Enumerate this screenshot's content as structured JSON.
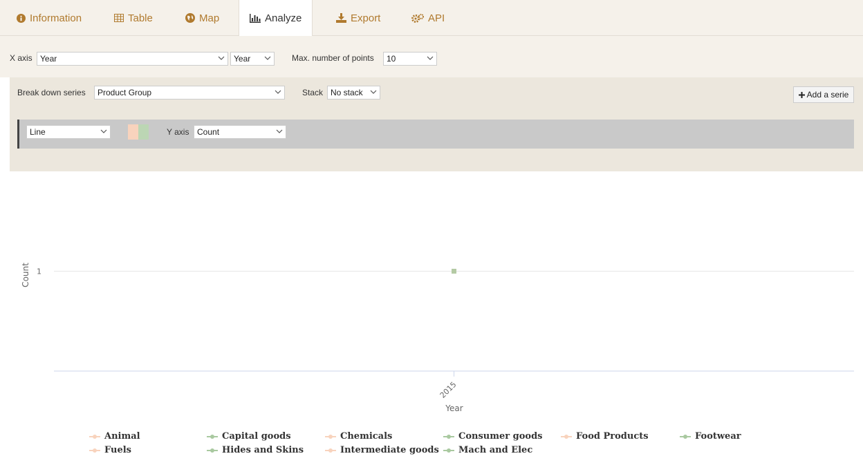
{
  "tabs": [
    {
      "label": "Information",
      "icon": "info-icon"
    },
    {
      "label": "Table",
      "icon": "table-icon"
    },
    {
      "label": "Map",
      "icon": "globe-icon"
    },
    {
      "label": "Analyze",
      "icon": "bar-chart-icon",
      "active": true
    },
    {
      "label": "Export",
      "icon": "download-icon"
    },
    {
      "label": "API",
      "icon": "cogs-icon"
    }
  ],
  "xaxis": {
    "label": "X axis",
    "field_value": "Year",
    "granularity_value": "Year",
    "max_points_label": "Max. number of points",
    "max_points_value": "10"
  },
  "breakdown": {
    "label": "Break down series",
    "value": "Product Group",
    "stack_label": "Stack",
    "stack_value": "No stack",
    "add_label": "Add a serie"
  },
  "serie": {
    "type_value": "Line",
    "yaxis_label": "Y axis",
    "yaxis_value": "Count",
    "colors": [
      "#f8d3bd",
      "#bcd6b4"
    ]
  },
  "colors": {
    "accent": "#b07a2e",
    "peach": "#f8d3bd",
    "green": "#a9c9a0"
  },
  "chart_data": {
    "type": "line",
    "x": [
      "2015"
    ],
    "xlabel": "Year",
    "ylabel": "Count",
    "y_ticks": [
      "1"
    ],
    "series": [
      {
        "name": "Animal",
        "values": [
          1
        ],
        "color": "#f8d3bd"
      },
      {
        "name": "Capital goods",
        "values": [
          1
        ],
        "color": "#a9c9a0"
      },
      {
        "name": "Chemicals",
        "values": [
          1
        ],
        "color": "#f8d3bd"
      },
      {
        "name": "Consumer goods",
        "values": [
          1
        ],
        "color": "#a9c9a0"
      },
      {
        "name": "Food Products",
        "values": [
          1
        ],
        "color": "#f8d3bd"
      },
      {
        "name": "Footwear",
        "values": [
          1
        ],
        "color": "#a9c9a0"
      },
      {
        "name": "Fuels",
        "values": [
          1
        ],
        "color": "#f8d3bd"
      },
      {
        "name": "Hides and Skins",
        "values": [
          1
        ],
        "color": "#a9c9a0"
      },
      {
        "name": "Intermediate goods",
        "values": [
          1
        ],
        "color": "#f8d3bd"
      },
      {
        "name": "Mach and Elec",
        "values": [
          1
        ],
        "color": "#a9c9a0"
      }
    ],
    "legend_position": "bottom"
  }
}
